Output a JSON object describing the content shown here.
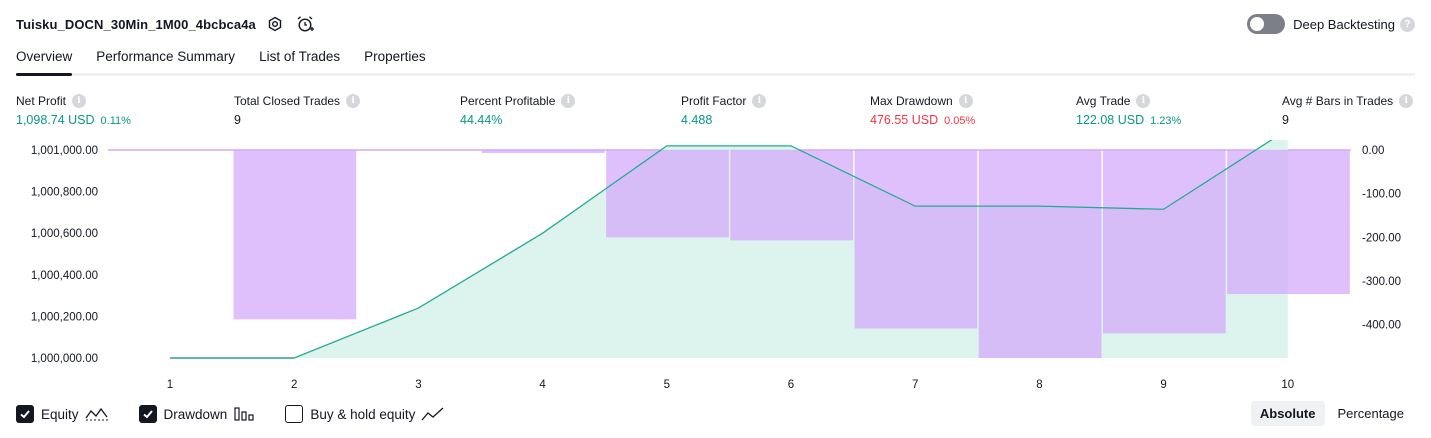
{
  "header": {
    "strategy_name": "Tuisku_DOCN_30Min_1M00_4bcbca4a",
    "deep_backtesting_label": "Deep Backtesting",
    "help_glyph": "?"
  },
  "tabs": [
    {
      "label": "Overview",
      "active": true
    },
    {
      "label": "Performance Summary",
      "active": false
    },
    {
      "label": "List of Trades",
      "active": false
    },
    {
      "label": "Properties",
      "active": false
    }
  ],
  "stats": [
    {
      "label": "Net Profit",
      "value": "1,098.74 USD",
      "pct": "0.11%",
      "color": "green"
    },
    {
      "label": "Total Closed Trades",
      "value": "9",
      "pct": "",
      "color": "plain"
    },
    {
      "label": "Percent Profitable",
      "value": "44.44%",
      "pct": "",
      "color": "green"
    },
    {
      "label": "Profit Factor",
      "value": "4.488",
      "pct": "",
      "color": "green"
    },
    {
      "label": "Max Drawdown",
      "value": "476.55 USD",
      "pct": "0.05%",
      "color": "red"
    },
    {
      "label": "Avg Trade",
      "value": "122.08 USD",
      "pct": "1.23%",
      "color": "green"
    },
    {
      "label": "Avg # Bars in Trades",
      "value": "9",
      "pct": "",
      "color": "plain"
    }
  ],
  "chart_data": {
    "type": "area",
    "x": [
      1,
      2,
      3,
      4,
      5,
      6,
      7,
      8,
      9,
      10
    ],
    "left_axis": {
      "ticks": [
        "1,000,000.00",
        "1,000,200.00",
        "1,000,400.00",
        "1,000,600.00",
        "1,000,800.00",
        "1,001,000.00"
      ],
      "range": [
        1000000,
        1001000
      ]
    },
    "right_axis": {
      "ticks": [
        "0.00",
        "-100.00",
        "-200.00",
        "-300.00",
        "-400.00"
      ],
      "range": [
        -476.55,
        0
      ]
    },
    "series": [
      {
        "name": "Equity",
        "kind": "area",
        "axis": "left",
        "values": [
          1000000,
          1000000,
          1000240,
          1000600,
          1001020,
          1001020,
          1000730,
          1000730,
          1000715,
          1001098.74
        ]
      },
      {
        "name": "Drawdown",
        "kind": "bar",
        "axis": "right",
        "values": [
          0,
          -388,
          0,
          -7,
          -200,
          -207,
          -409,
          -476.55,
          -420,
          -330
        ]
      }
    ],
    "colors": {
      "equity_line": "#22ab94",
      "equity_fill": "#d7f1ea",
      "drawdown_bar": "#d3a8fc",
      "baseline": "#9e8fa6"
    }
  },
  "legend": [
    {
      "label": "Equity",
      "checked": true,
      "icon": "equity-wave-icon"
    },
    {
      "label": "Drawdown",
      "checked": true,
      "icon": "drawdown-bars-icon"
    },
    {
      "label": "Buy & hold equity",
      "checked": false,
      "icon": "buy-hold-line-icon"
    }
  ],
  "modes": [
    {
      "label": "Absolute",
      "active": true
    },
    {
      "label": "Percentage",
      "active": false
    }
  ],
  "icons": {
    "settings": "settings-gear-icon",
    "alert": "alarm-clock-icon"
  }
}
